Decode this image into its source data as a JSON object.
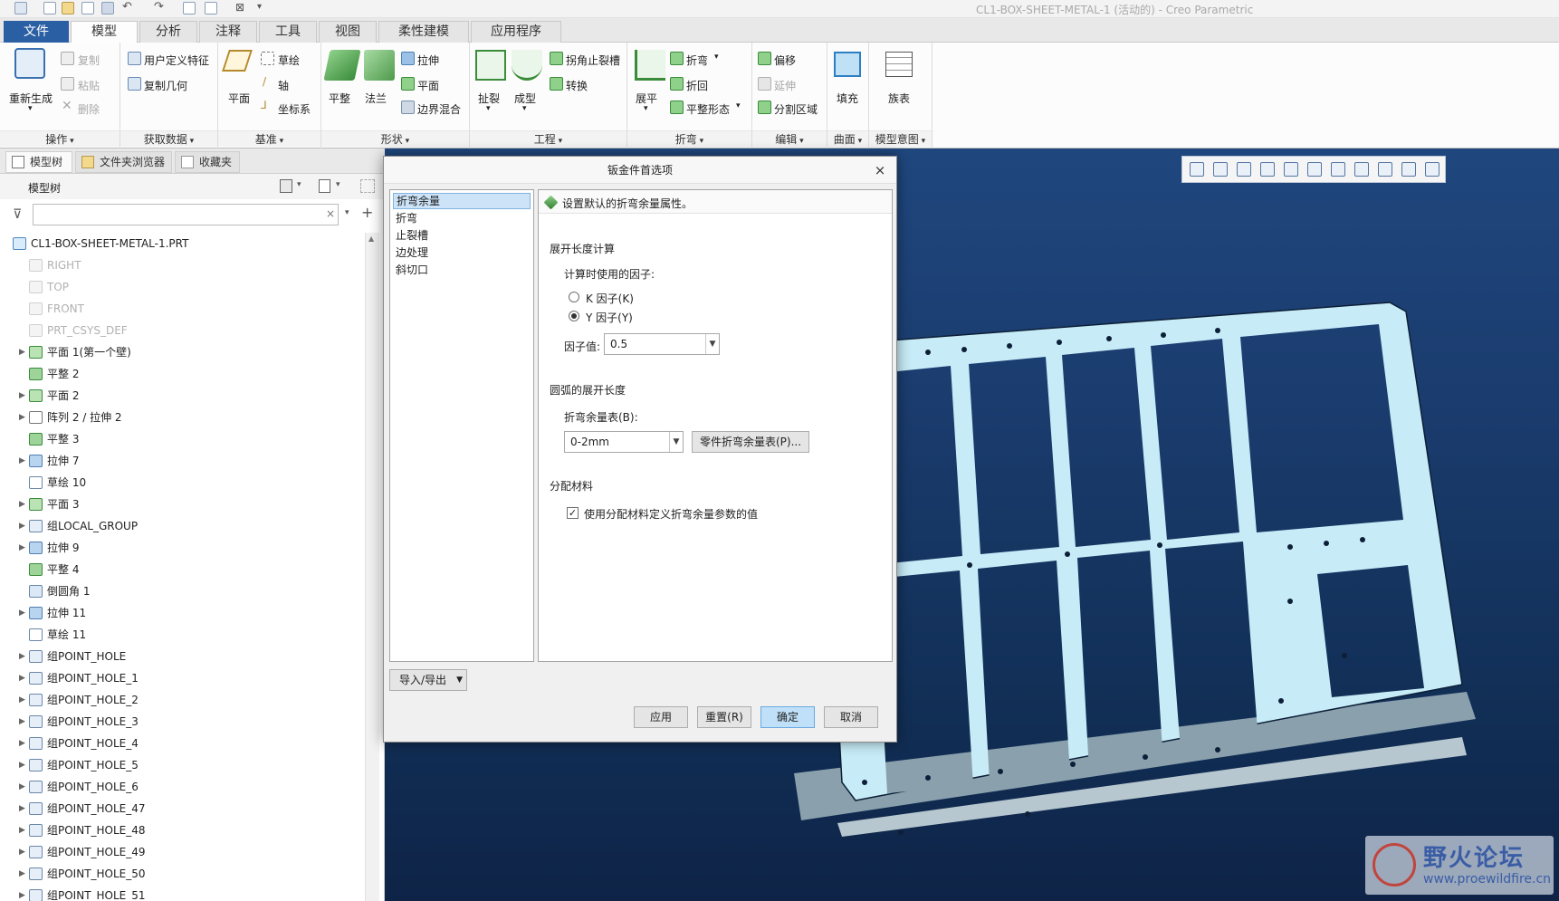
{
  "window": {
    "title": "CL1-BOX-SHEET-METAL-1 (活动的) - Creo Parametric"
  },
  "tabs": [
    {
      "label": "文件"
    },
    {
      "label": "模型"
    },
    {
      "label": "分析"
    },
    {
      "label": "注释"
    },
    {
      "label": "工具"
    },
    {
      "label": "视图"
    },
    {
      "label": "柔性建模"
    },
    {
      "label": "应用程序"
    }
  ],
  "ribbon": {
    "groups": {
      "operations": {
        "label": "操作",
        "regenerate": "重新生成",
        "copy": "复制",
        "paste": "粘贴",
        "delete": "删除"
      },
      "get_data": {
        "label": "获取数据",
        "udf": "用户定义特征",
        "copy_geom": "复制几何"
      },
      "datum": {
        "label": "基准",
        "plane": "平面",
        "sketch": "草绘",
        "axis": "轴",
        "csys": "坐标系"
      },
      "shapes": {
        "label": "形状",
        "flat": "平整",
        "flange": "法兰",
        "extrude": "拉伸",
        "planar": "平面",
        "boundary_blend": "边界混合"
      },
      "engineering": {
        "label": "工程",
        "rip": "扯裂",
        "form": "成型",
        "corner_relief": "拐角止裂槽",
        "convert": "转换"
      },
      "bends": {
        "label": "折弯",
        "unbend": "展平",
        "bend": "折弯",
        "bend_back": "折回",
        "flat_state": "平整形态"
      },
      "editing": {
        "label": "编辑",
        "offset": "偏移",
        "extend": "延伸",
        "split_area": "分割区域"
      },
      "surfaces": {
        "label": "曲面",
        "fill": "填充"
      },
      "model_intent": {
        "label": "模型意图",
        "family_table": "族表"
      }
    }
  },
  "left_panel": {
    "tabs": [
      {
        "label": "模型树"
      },
      {
        "label": "文件夹浏览器"
      },
      {
        "label": "收藏夹"
      }
    ],
    "tree_header": "模型树",
    "filter_placeholder": "",
    "items": [
      {
        "label": "CL1-BOX-SHEET-METAL-1.PRT",
        "icon": "part-icon",
        "expandable": false,
        "dim": false,
        "level": 0
      },
      {
        "label": "RIGHT",
        "icon": "datum-plane-icon",
        "expandable": false,
        "dim": true,
        "level": 1
      },
      {
        "label": "TOP",
        "icon": "datum-plane-icon",
        "expandable": false,
        "dim": true,
        "level": 1
      },
      {
        "label": "FRONT",
        "icon": "datum-plane-icon",
        "expandable": false,
        "dim": true,
        "level": 1
      },
      {
        "label": "PRT_CSYS_DEF",
        "icon": "csys-icon",
        "expandable": false,
        "dim": true,
        "level": 1
      },
      {
        "label": "平面 1(第一个壁)",
        "icon": "planar-wall-icon",
        "expandable": true,
        "dim": false,
        "level": 1
      },
      {
        "label": "平整 2",
        "icon": "flat-wall-icon",
        "expandable": false,
        "dim": false,
        "level": 1
      },
      {
        "label": "平面 2",
        "icon": "planar-wall-icon",
        "expandable": true,
        "dim": false,
        "level": 1
      },
      {
        "label": "阵列 2 / 拉伸 2",
        "icon": "pattern-icon",
        "expandable": true,
        "dim": false,
        "level": 1
      },
      {
        "label": "平整 3",
        "icon": "flat-wall-icon",
        "expandable": false,
        "dim": false,
        "level": 1
      },
      {
        "label": "拉伸 7",
        "icon": "extrude-icon",
        "expandable": true,
        "dim": false,
        "level": 1
      },
      {
        "label": "草绘 10",
        "icon": "sketch-icon",
        "expandable": false,
        "dim": false,
        "level": 1
      },
      {
        "label": "平面 3",
        "icon": "planar-wall-icon",
        "expandable": true,
        "dim": false,
        "level": 1
      },
      {
        "label": "组LOCAL_GROUP",
        "icon": "group-icon",
        "expandable": true,
        "dim": false,
        "level": 1
      },
      {
        "label": "拉伸 9",
        "icon": "extrude-icon",
        "expandable": true,
        "dim": false,
        "level": 1
      },
      {
        "label": "平整 4",
        "icon": "flat-wall-icon",
        "expandable": false,
        "dim": false,
        "level": 1
      },
      {
        "label": "倒圆角 1",
        "icon": "round-icon",
        "expandable": false,
        "dim": false,
        "level": 1
      },
      {
        "label": "拉伸 11",
        "icon": "extrude-icon",
        "expandable": true,
        "dim": false,
        "level": 1
      },
      {
        "label": "草绘 11",
        "icon": "sketch-icon",
        "expandable": false,
        "dim": false,
        "level": 1
      },
      {
        "label": "组POINT_HOLE",
        "icon": "group-icon",
        "expandable": true,
        "dim": false,
        "level": 1
      },
      {
        "label": "组POINT_HOLE_1",
        "icon": "group-icon",
        "expandable": true,
        "dim": false,
        "level": 1
      },
      {
        "label": "组POINT_HOLE_2",
        "icon": "group-icon",
        "expandable": true,
        "dim": false,
        "level": 1
      },
      {
        "label": "组POINT_HOLE_3",
        "icon": "group-icon",
        "expandable": true,
        "dim": false,
        "level": 1
      },
      {
        "label": "组POINT_HOLE_4",
        "icon": "group-icon",
        "expandable": true,
        "dim": false,
        "level": 1
      },
      {
        "label": "组POINT_HOLE_5",
        "icon": "group-icon",
        "expandable": true,
        "dim": false,
        "level": 1
      },
      {
        "label": "组POINT_HOLE_6",
        "icon": "group-icon",
        "expandable": true,
        "dim": false,
        "level": 1
      },
      {
        "label": "组POINT_HOLE_47",
        "icon": "group-icon",
        "expandable": true,
        "dim": false,
        "level": 1
      },
      {
        "label": "组POINT_HOLE_48",
        "icon": "group-icon",
        "expandable": true,
        "dim": false,
        "level": 1
      },
      {
        "label": "组POINT_HOLE_49",
        "icon": "group-icon",
        "expandable": true,
        "dim": false,
        "level": 1
      },
      {
        "label": "组POINT_HOLE_50",
        "icon": "group-icon",
        "expandable": true,
        "dim": false,
        "level": 1
      },
      {
        "label": "组POINT_HOLE_51",
        "icon": "group-icon",
        "expandable": true,
        "dim": false,
        "level": 1
      }
    ]
  },
  "dialog": {
    "title": "钣金件首选项",
    "close": "×",
    "categories": [
      {
        "label": "折弯余量",
        "selected": true
      },
      {
        "label": "折弯",
        "selected": false
      },
      {
        "label": "止裂槽",
        "selected": false
      },
      {
        "label": "边处理",
        "selected": false
      },
      {
        "label": "斜切口",
        "selected": false
      }
    ],
    "header_text": "设置默认的折弯余量属性。",
    "section1_title": "展开长度计算",
    "factor_label": "计算时使用的因子:",
    "k_factor": "K 因子(K)",
    "y_factor": "Y 因子(Y)",
    "factor_value_label": "因子值:",
    "factor_value": "0.5",
    "section2_title": "圆弧的展开长度",
    "bend_table_label": "折弯余量表(B):",
    "bend_table_value": "0-2mm",
    "part_table_button": "零件折弯余量表(P)...",
    "section3_title": "分配材料",
    "use_material_label": "使用分配材料定义折弯余量参数的值",
    "use_material_checked": true,
    "import_export": "导入/导出",
    "apply": "应用",
    "reset": "重置(R)",
    "ok": "确定",
    "cancel": "取消"
  },
  "watermark": {
    "text": "野火论坛",
    "url": "www.proewildfire.cn"
  },
  "colors": {
    "accent": "#2b5fa3",
    "viewport_bg": "#1b3d70",
    "part": "#bfeaf6",
    "arrow": "#1a9ad6"
  }
}
